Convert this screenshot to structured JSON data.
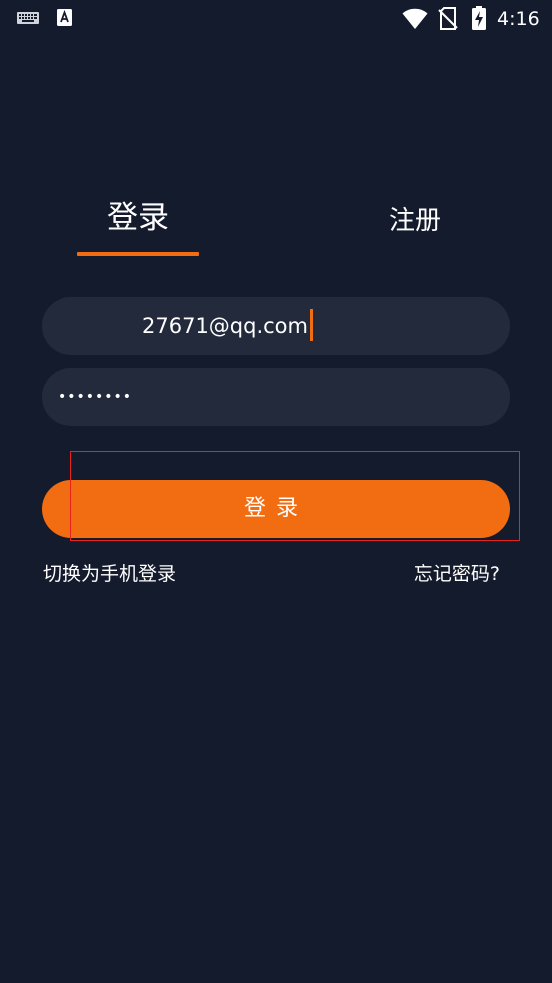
{
  "status_bar": {
    "time": "4:16",
    "icons": [
      "keyboard-icon",
      "a-notification-icon",
      "wifi-icon",
      "no-sim-icon",
      "battery-charging-icon"
    ]
  },
  "tabs": [
    {
      "label": "登录",
      "active": true
    },
    {
      "label": "注册",
      "active": false
    }
  ],
  "form": {
    "email": {
      "value": "27671@qq.com"
    },
    "password": {
      "value": "••••••••"
    },
    "login_button_label": "登录"
  },
  "links": {
    "switch_to_phone": "切换为手机登录",
    "forgot_password": "忘记密码?"
  },
  "colors": {
    "background": "#141b2d",
    "input_background": "#222a3b",
    "accent": "#f26c12",
    "highlight_box": "#e8231d"
  }
}
